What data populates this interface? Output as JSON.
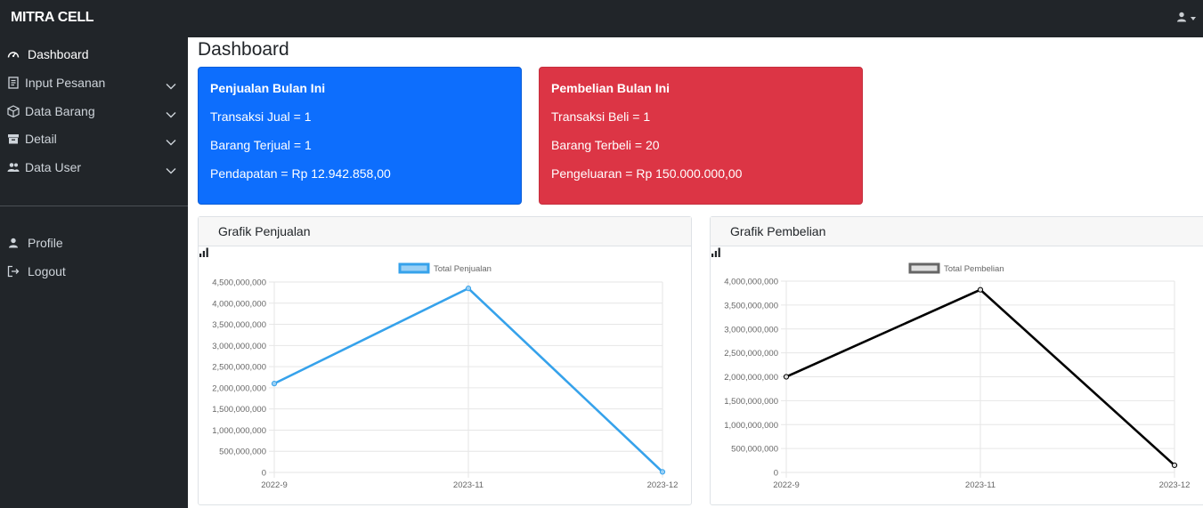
{
  "topbar": {
    "brand": "MITRA CELL",
    "user_icon": "user-icon"
  },
  "sidebar": {
    "items": [
      {
        "label": "Dashboard",
        "icon": "gauge-icon",
        "active": true
      },
      {
        "label": "Input Pesanan",
        "icon": "receipt-icon",
        "has_children": true
      },
      {
        "label": "Data Barang",
        "icon": "box-icon",
        "has_children": true
      },
      {
        "label": "Detail",
        "icon": "archive-icon",
        "has_children": true
      },
      {
        "label": "Data User",
        "icon": "users-icon",
        "has_children": true
      }
    ],
    "bottom_items": [
      {
        "label": "Profile",
        "icon": "user-icon"
      },
      {
        "label": "Logout",
        "icon": "logout-icon"
      }
    ]
  },
  "main": {
    "title": "Dashboard",
    "sales_card": {
      "title": "Penjualan Bulan Ini",
      "line1": "Transaksi Jual = 1",
      "line2": "Barang Terjual = 1",
      "line3": "Pendapatan = Rp 12.942.858,00",
      "color": "#0d6efd"
    },
    "purchase_card": {
      "title": "Pembelian Bulan Ini",
      "line1": "Transaksi Beli = 1",
      "line2": "Barang Terbeli = 20",
      "line3": "Pengeluaran = Rp 150.000.000,00",
      "color": "#dc3545"
    },
    "sales_chart_title": "Grafik Penjualan",
    "purchase_chart_title": "Grafik Pembelian"
  },
  "chart_data": [
    {
      "type": "line",
      "title": "",
      "categories": [
        "2022-9",
        "2023-11",
        "2023-12"
      ],
      "series": [
        {
          "name": "Total Penjualan",
          "values": [
            2100000000,
            4350000000,
            12942858
          ],
          "color": "#36a2eb"
        }
      ],
      "ylim": [
        0,
        4500000000
      ],
      "yticks": [
        "4,500,000,000",
        "4,000,000,000",
        "3,500,000,000",
        "3,000,000,000",
        "2,500,000,000",
        "2,000,000,000",
        "1,500,000,000",
        "1,000,000,000",
        "500,000,000",
        "0"
      ],
      "grid": true,
      "legend": "top"
    },
    {
      "type": "line",
      "title": "",
      "categories": [
        "2022-9",
        "2023-11",
        "2023-12"
      ],
      "series": [
        {
          "name": "Total Pembelian",
          "values": [
            2000000000,
            3820000000,
            150000000
          ],
          "color": "#000000"
        }
      ],
      "ylim": [
        0,
        4000000000
      ],
      "yticks": [
        "4,000,000,000",
        "3,500,000,000",
        "3,000,000,000",
        "2,500,000,000",
        "2,000,000,000",
        "1,500,000,000",
        "1,000,000,000",
        "500,000,000",
        "0"
      ],
      "grid": true,
      "legend": "top"
    }
  ]
}
